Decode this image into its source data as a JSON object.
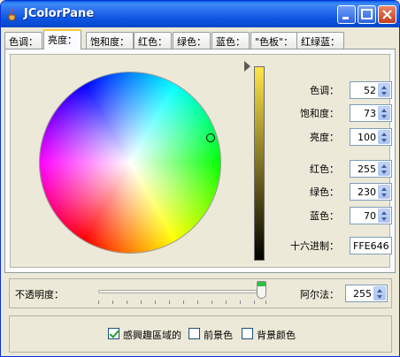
{
  "window": {
    "title": "JColorPane"
  },
  "tabs": [
    "色调：",
    "亮度：",
    "饱和度：",
    "红色：",
    "绿色：",
    "蓝色：",
    "\"色板\"：",
    "红绿蓝："
  ],
  "active_tab": "亮度：",
  "fields": {
    "hue": {
      "label": "色调：",
      "value": "52"
    },
    "saturation": {
      "label": "饱和度：",
      "value": "73"
    },
    "brightness": {
      "label": "亮度：",
      "value": "100"
    },
    "red": {
      "label": "红色：",
      "value": "255"
    },
    "green": {
      "label": "绿色：",
      "value": "230"
    },
    "blue": {
      "label": "蓝色：",
      "value": "70"
    },
    "hex": {
      "label": "十六进制：",
      "value": "FFE646"
    }
  },
  "opacity": {
    "label": "不透明度：",
    "alpha_label": "阿尔法：",
    "alpha_value": "255",
    "slider_fraction": 1.0
  },
  "checkboxes": [
    {
      "label": "感興趣區域的",
      "checked": true
    },
    {
      "label": "前景色",
      "checked": false
    },
    {
      "label": "背景颜色",
      "checked": false
    }
  ],
  "colors": {
    "current": "#FFE646",
    "title_bar": "#0A53E0",
    "tab_highlight": "#FFC83C"
  }
}
